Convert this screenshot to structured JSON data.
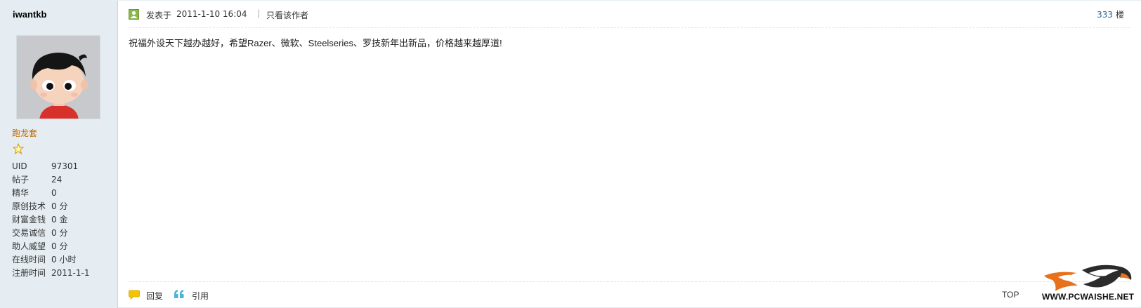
{
  "user": {
    "name": "iwantkb",
    "group": "跑龙套",
    "stats": [
      {
        "label": "UID",
        "value": "97301"
      },
      {
        "label": "帖子",
        "value": "24"
      },
      {
        "label": "精华",
        "value": "0"
      },
      {
        "label": "原创技术",
        "value": "0 分"
      },
      {
        "label": "财富金钱",
        "value": "0 金"
      },
      {
        "label": "交易诚信",
        "value": "0 分"
      },
      {
        "label": "助人威望",
        "value": "0 分"
      },
      {
        "label": "在线时间",
        "value": "0 小时"
      },
      {
        "label": "注册时间",
        "value": "2011-1-1"
      }
    ]
  },
  "post": {
    "posted_label": "发表于",
    "posted_time": "2011-1-10 16:04",
    "separator": "|",
    "only_author_label": "只看该作者",
    "floor_number": "333",
    "floor_suffix": "楼",
    "content": "祝福外设天下越办越好，希望Razer、微软、Steelseries、罗技新年出新品，价格越来越厚道!",
    "reply_label": "回复",
    "quote_label": "引用",
    "top_label": "TOP"
  },
  "watermark": {
    "text": "WWW.PCWAISHE.NET"
  },
  "colors": {
    "sidebar_bg": "#e5edf2",
    "group_name": "#c06a00",
    "floor_link": "#336699"
  }
}
